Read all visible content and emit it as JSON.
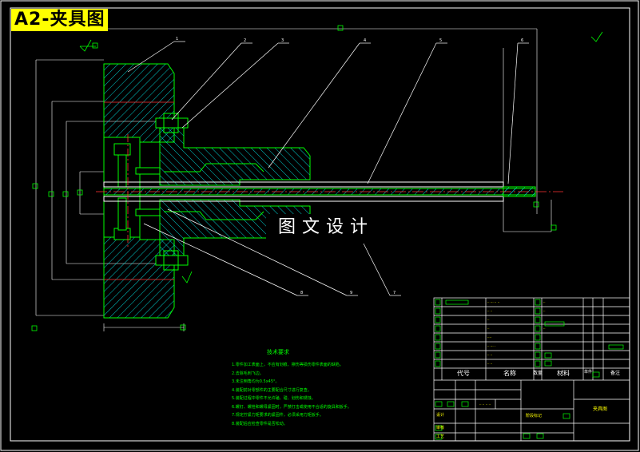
{
  "title": "A2-夹具图",
  "watermark": "图文设计",
  "balloons": [
    "1",
    "2",
    "3",
    "4",
    "5",
    "6",
    "8",
    "9",
    "7"
  ],
  "tech_requirements": {
    "heading": "技术要求",
    "lines": [
      "1.零件加工表面上，不应有划痕、擦伤等损伤零件表面的缺陷。",
      "2.去除毛刺飞边。",
      "3.未注倒角均为0.5x45°。",
      "4.装配前对零部件的主要配合尺寸进行复查。",
      "5.装配过程中零件不允许磕、碰、划伤和锈蚀。",
      "6.螺钉、螺栓和螺母紧固时，严禁打击或使用不合适的旋具和扳手。",
      "7.规定拧紧力矩要求的紧固件，必须采用力矩扳手。",
      "8.装配后应检查零件是否松动。"
    ]
  },
  "title_block": {
    "col_code": "代号",
    "col_name": "名称",
    "col_qty": "数量",
    "col_material": "材料",
    "col_weight": "单件",
    "col_remark": "备注",
    "drawing_name": "夹具图",
    "stage_label": "阶段标记",
    "design": "设计",
    "check": "审核",
    "craft": "工艺"
  },
  "colors": {
    "outline": "#00ff00",
    "section": "#00ffff",
    "dimension": "#ffffff",
    "centerline": "#ff3333",
    "leader": "#ffffff",
    "title_bg": "#ffff00"
  }
}
